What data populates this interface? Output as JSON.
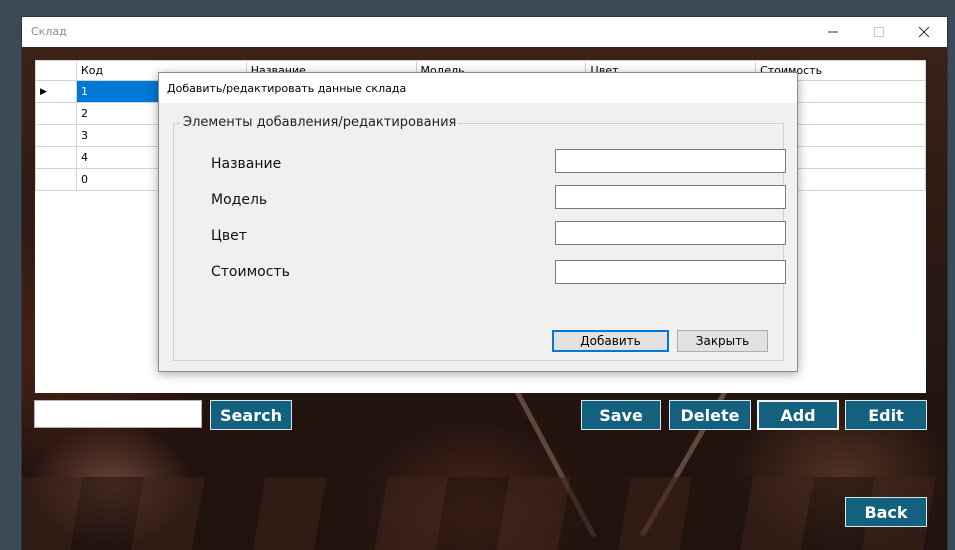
{
  "window": {
    "title": "Склад",
    "minimize_icon": "minimize-icon",
    "maximize_icon": "maximize-icon",
    "close_icon": "close-icon"
  },
  "grid": {
    "columns": [
      "Код",
      "Название",
      "Модель",
      "Цвет",
      "Стоимость"
    ],
    "rows": [
      {
        "code": "1",
        "name": "",
        "model": "",
        "color": "",
        "cost": "",
        "selected": true
      },
      {
        "code": "2",
        "name": "",
        "model": "",
        "color": "",
        "cost": "",
        "selected": false
      },
      {
        "code": "3",
        "name": "",
        "model": "",
        "color": "",
        "cost": "",
        "selected": false
      },
      {
        "code": "4",
        "name": "",
        "model": "",
        "color": "",
        "cost": "",
        "selected": false
      },
      {
        "code": "0",
        "name": "",
        "model": "",
        "color": "",
        "cost": "",
        "selected": false
      }
    ],
    "current_row_icon": "row-pointer-icon"
  },
  "search": {
    "value": "",
    "button_label": "Search"
  },
  "actions": {
    "save_label": "Save",
    "delete_label": "Delete",
    "add_label": "Add",
    "edit_label": "Edit",
    "back_label": "Back"
  },
  "dialog": {
    "title": "Добавить/редактировать данные склада",
    "group_title": "Элементы добавления/редактирования",
    "fields": [
      {
        "label": "Название",
        "value": ""
      },
      {
        "label": "Модель",
        "value": ""
      },
      {
        "label": "Цвет",
        "value": ""
      },
      {
        "label": "Стоимость",
        "value": ""
      }
    ],
    "add_button_label": "Добавить",
    "close_button_label": "Закрыть"
  },
  "colors": {
    "accent_button": "#13607f",
    "selection": "#0078d7"
  }
}
